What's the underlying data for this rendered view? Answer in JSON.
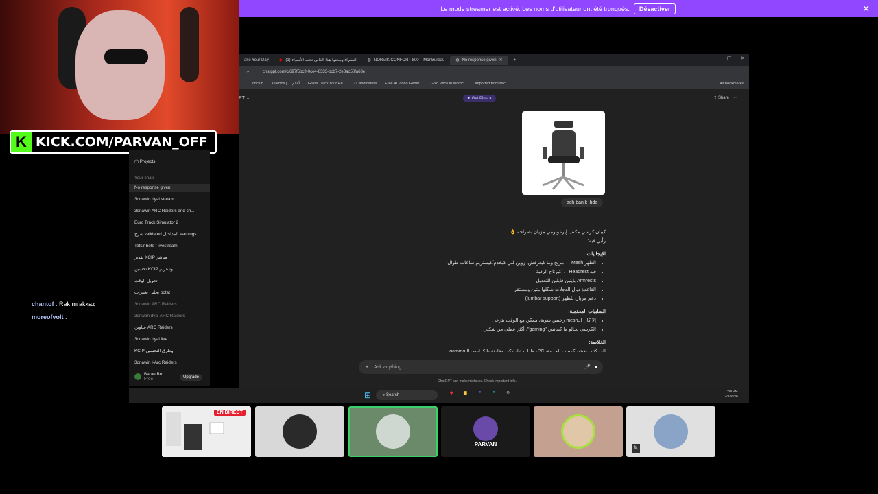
{
  "banner": {
    "message": "Le mode streamer est activé. Les noms d'utilisateur ont été tronqués.",
    "button": "Désactiver"
  },
  "overlay": {
    "kick_url": "KICK.COM/PARVAN_OFF"
  },
  "chat": [
    {
      "user": "chantof",
      "message": "Rak mrakkaz"
    },
    {
      "user": "moreofvolt",
      "message": ""
    }
  ],
  "browser": {
    "tabs": [
      "ake Your Day",
      "(1) الفقراء ومحتوا هذا الغاني تحت الأضواء",
      "NORVIK CONFORT 800 – MonBureau",
      "No response given"
    ],
    "url": "chatgpt.com/c/697f5bc9-0ce4-8333-bcb7-2e8ac58fa68e",
    "bookmarks": [
      "cdclub",
      "TeleBox | ... أفلام",
      "Grass Track Your Re...",
      "/ Candidature",
      "Free AI Video Gener...",
      "Gold Price in Moroc...",
      "Imported from Mic..."
    ],
    "all_bookmarks": "All Bookmarks"
  },
  "chatgpt": {
    "model": "PT",
    "get_plus": "Get Plus",
    "share": "Share",
    "image_caption": "ach banlk lhda",
    "answer": {
      "intro": "كيبان كرسي مكتب إيرغونومي مزيان بصراحة 👌",
      "opinion": "رأيي فيه:",
      "pros_title": "الإيجابيات:",
      "pros": [
        "الظهر Mesh ← مريح وما كيعرقش، زوين للي كيخدم/كيستريم ساعات طوال",
        "فيه Headrest ← كيرتاح الرقبة",
        "Armrests باينين قابلين للتعديل",
        "القاعدة ديال العجلات شكلها متين ومستقر",
        "دعم مزيان للظهر (lumbar support)"
      ],
      "cons_title": "السلبيات المحتملة:",
      "cons": [
        "إلا كان الـmesh رخيص شوية، ممكن مع الوقت يترخى",
        "الكرسي بحالو ما كيبانش \"gaming\"، أكثر عملي من شكلي"
      ],
      "summary_title": "الخلاصة:",
      "summary_text": "إلى كنتي بغيتي كرسي للخدمة، PC، هادا اختيار ذكي مقارنة بالكراسي الـgaming"
    },
    "composer_placeholder": "Ask anything",
    "disclaimer": "ChatGPT can make mistakes. Check important info."
  },
  "sidebar": {
    "projects": "Projects",
    "your_chats": "Your chats",
    "items": [
      "No response given",
      "3onawin dyal stream",
      "3onawin ARC Raiders and ch...",
      "Euro Truck Simulator 2",
      "شرح validated المداخيل earnings",
      "Tafsir bots f livestream",
      "تقدير KCIP مباشر",
      "تحسين KCIP وستريم",
      "تحويل الوقت",
      "تحليل تغييرات botat",
      "3onawin ARC Raiders",
      "3onwan dyal ARC Raiders",
      "عناوين ARC Raiders",
      "3onawin dyal live",
      "KCIP وطرق التحسين",
      "3onawin l-Arc Raiders"
    ],
    "user_name": "Barae Brr",
    "user_plan": "Free",
    "upgrade": "Upgrade"
  },
  "taskbar": {
    "search": "Search",
    "time": "7:30 PM",
    "date": "2/1/2026"
  },
  "participants": {
    "live_badge": "EN DIRECT",
    "parvan_logo": "PARVAN"
  }
}
